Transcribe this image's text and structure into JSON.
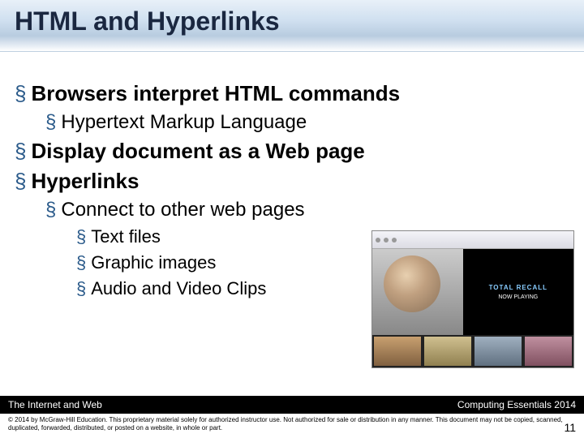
{
  "title": "HTML and Hyperlinks",
  "bullets": {
    "b1_1": "Browsers interpret HTML commands",
    "b2_1": "Hypertext Markup Language",
    "b1_2": "Display document as a Web page",
    "b1_3": "Hyperlinks",
    "b2_2": "Connect to other web pages",
    "b3_1": "Text files",
    "b3_2": "Graphic images",
    "b3_3": "Audio and Video Clips"
  },
  "thumb": {
    "right_line1": "TOTAL RECALL",
    "right_line2": "NOW PLAYING"
  },
  "footer": {
    "left": "The Internet and Web",
    "right": "Computing Essentials 2014",
    "copyright": "© 2014 by McGraw-Hill Education. This proprietary material solely for authorized instructor use. Not authorized for sale or distribution in any manner. This document may not be copied, scanned, duplicated, forwarded, distributed, or posted on a website, in whole or part.",
    "page": "11"
  }
}
